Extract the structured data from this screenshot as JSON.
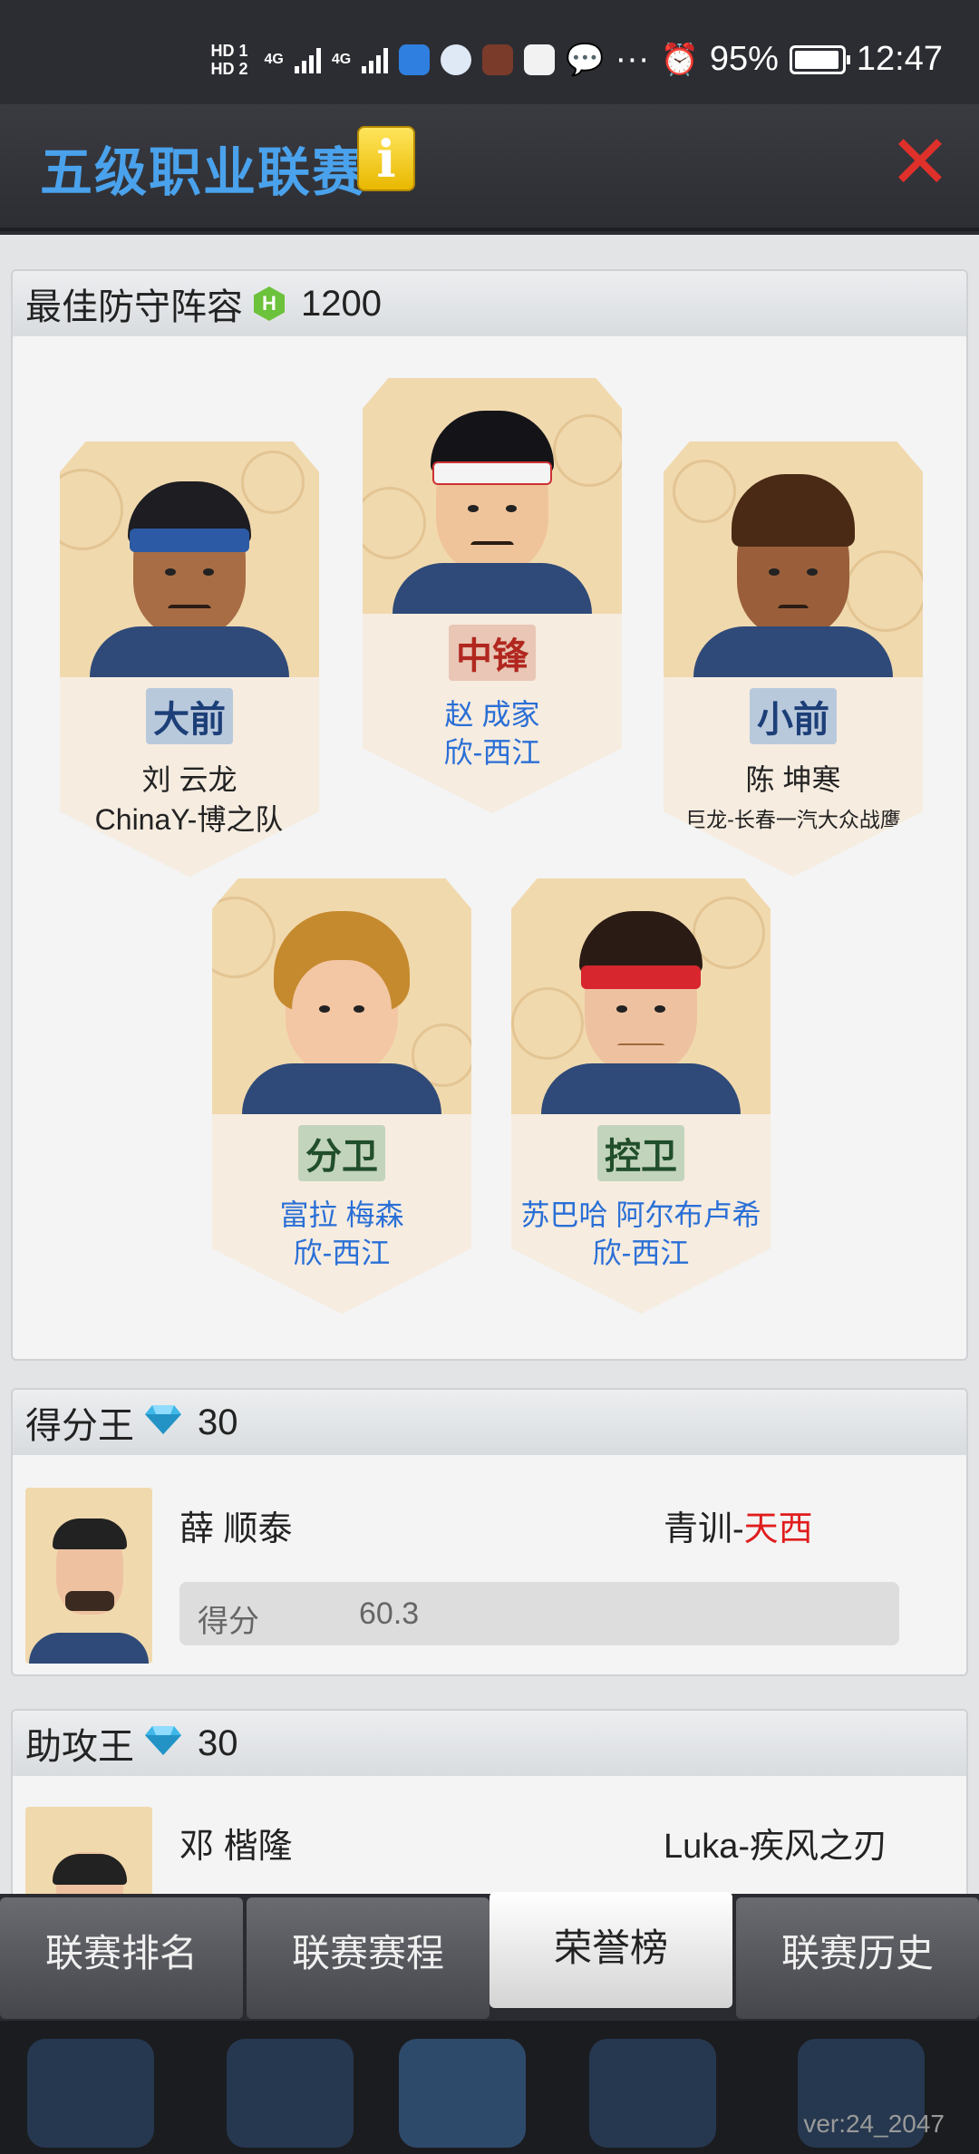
{
  "status_bar": {
    "hd1": "HD 1",
    "hd2": "HD 2",
    "net1": "4G",
    "net2": "4G",
    "more": "···",
    "battery": "95%",
    "time": "12:47"
  },
  "header": {
    "title": "五级职业联赛",
    "info_label": "i",
    "close_label": "✕"
  },
  "best_defense": {
    "title": "最佳防守阵容",
    "reward_value": "1200",
    "reward_icon": "h-coin-icon",
    "players": [
      {
        "position": "大前",
        "name": "刘 云龙",
        "team": "ChinaY-博之队"
      },
      {
        "position": "中锋",
        "name": "赵 成家",
        "team": "欣-西江"
      },
      {
        "position": "小前",
        "name": "陈 坤寒",
        "team": "巨龙-长春一汽大众战鹰"
      },
      {
        "position": "分卫",
        "name": "富拉 梅森",
        "team": "欣-西江"
      },
      {
        "position": "控卫",
        "name": "苏巴哈 阿尔布卢希",
        "team": "欣-西江"
      }
    ]
  },
  "scoring_king": {
    "title": "得分王",
    "reward_value": "30",
    "reward_icon": "diamond-icon",
    "player_name": "薛 顺泰",
    "team_prefix": "青训-",
    "team_highlight": "天西",
    "stat_label": "得分",
    "stat_value": "60.3"
  },
  "assist_king": {
    "title": "助攻王",
    "reward_value": "30",
    "reward_icon": "diamond-icon",
    "player_name": "邓 楷隆",
    "team": "Luka-疾风之刃"
  },
  "tabs": [
    {
      "label": "联赛排名",
      "active": false
    },
    {
      "label": "联赛赛程",
      "active": false
    },
    {
      "label": "荣誉榜",
      "active": true
    },
    {
      "label": "联赛历史",
      "active": false
    }
  ],
  "version": "ver:24_2047",
  "colors": {
    "title_blue": "#4aa2ec",
    "link_blue": "#2a6fd6",
    "close_red": "#e0302a",
    "highlight_red": "#e01d1d"
  }
}
